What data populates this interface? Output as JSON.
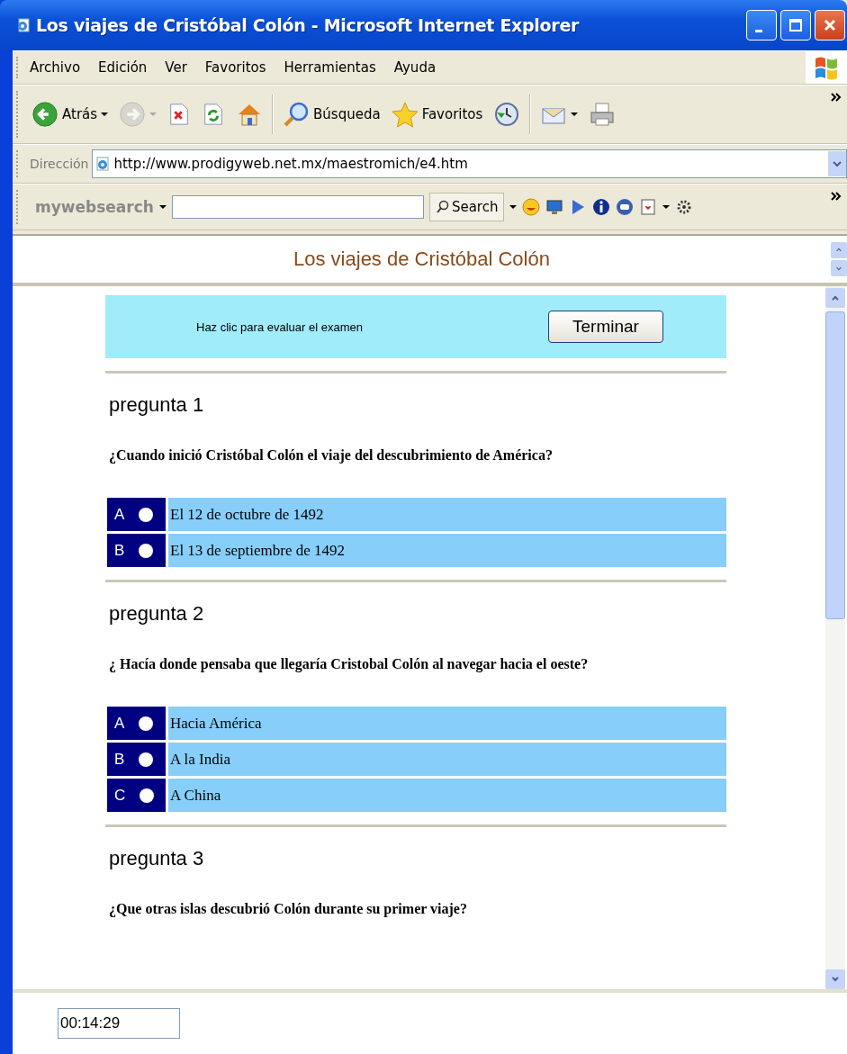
{
  "window": {
    "title": "Los viajes de Cristóbal Colón - Microsoft Internet Explorer"
  },
  "menu": [
    "Archivo",
    "Edición",
    "Ver",
    "Favoritos",
    "Herramientas",
    "Ayuda"
  ],
  "toolbar": [
    {
      "kind": "back",
      "label": "Atrás",
      "dropdown": true,
      "disabled": false
    },
    {
      "kind": "forward",
      "dropdown": true,
      "disabled": true
    },
    {
      "kind": "stop",
      "dropdown": false,
      "disabled": false
    },
    {
      "kind": "refresh",
      "dropdown": false,
      "disabled": false
    },
    {
      "kind": "home",
      "dropdown": false,
      "disabled": false
    },
    {
      "kind": "search",
      "label": "Búsqueda",
      "dropdown": false,
      "disabled": false
    },
    {
      "kind": "favorites",
      "label": "Favoritos",
      "dropdown": false,
      "disabled": false
    },
    {
      "kind": "history",
      "dropdown": false,
      "disabled": false
    },
    {
      "kind": "mail",
      "dropdown": true,
      "disabled": false
    },
    {
      "kind": "print",
      "dropdown": false,
      "disabled": false
    }
  ],
  "address": {
    "label": "Dirección",
    "value": "http://www.prodigyweb.net.mx/maestromich/e4.htm"
  },
  "websearch": {
    "brand": "mywebsearch",
    "search_button": "Search"
  },
  "page_title": "Los viajes de Cristóbal Colón",
  "banner": {
    "text": "Haz clic para evaluar el examen",
    "button": "Terminar"
  },
  "questions": [
    {
      "heading": "pregunta 1",
      "text": "¿Cuando inició Cristóbal Colón el viaje del descubrimiento de América?",
      "options": [
        {
          "letter": "A",
          "text": "El 12 de octubre de 1492",
          "selected": false
        },
        {
          "letter": "B",
          "text": "El 13 de septiembre de 1492",
          "selected": false
        }
      ]
    },
    {
      "heading": "pregunta 2",
      "text": "¿ Hacía donde pensaba que llegaría Cristobal Colón al navegar hacia el oeste?",
      "options": [
        {
          "letter": "A",
          "text": "Hacia América",
          "selected": false
        },
        {
          "letter": "B",
          "text": "A la India",
          "selected": false
        },
        {
          "letter": "C",
          "text": "A China",
          "selected": false
        }
      ]
    },
    {
      "heading": "pregunta 3",
      "text": "¿Que otras islas descubrió Colón durante su primer viaje?"
    }
  ],
  "timer": {
    "value": "00:14:29"
  }
}
